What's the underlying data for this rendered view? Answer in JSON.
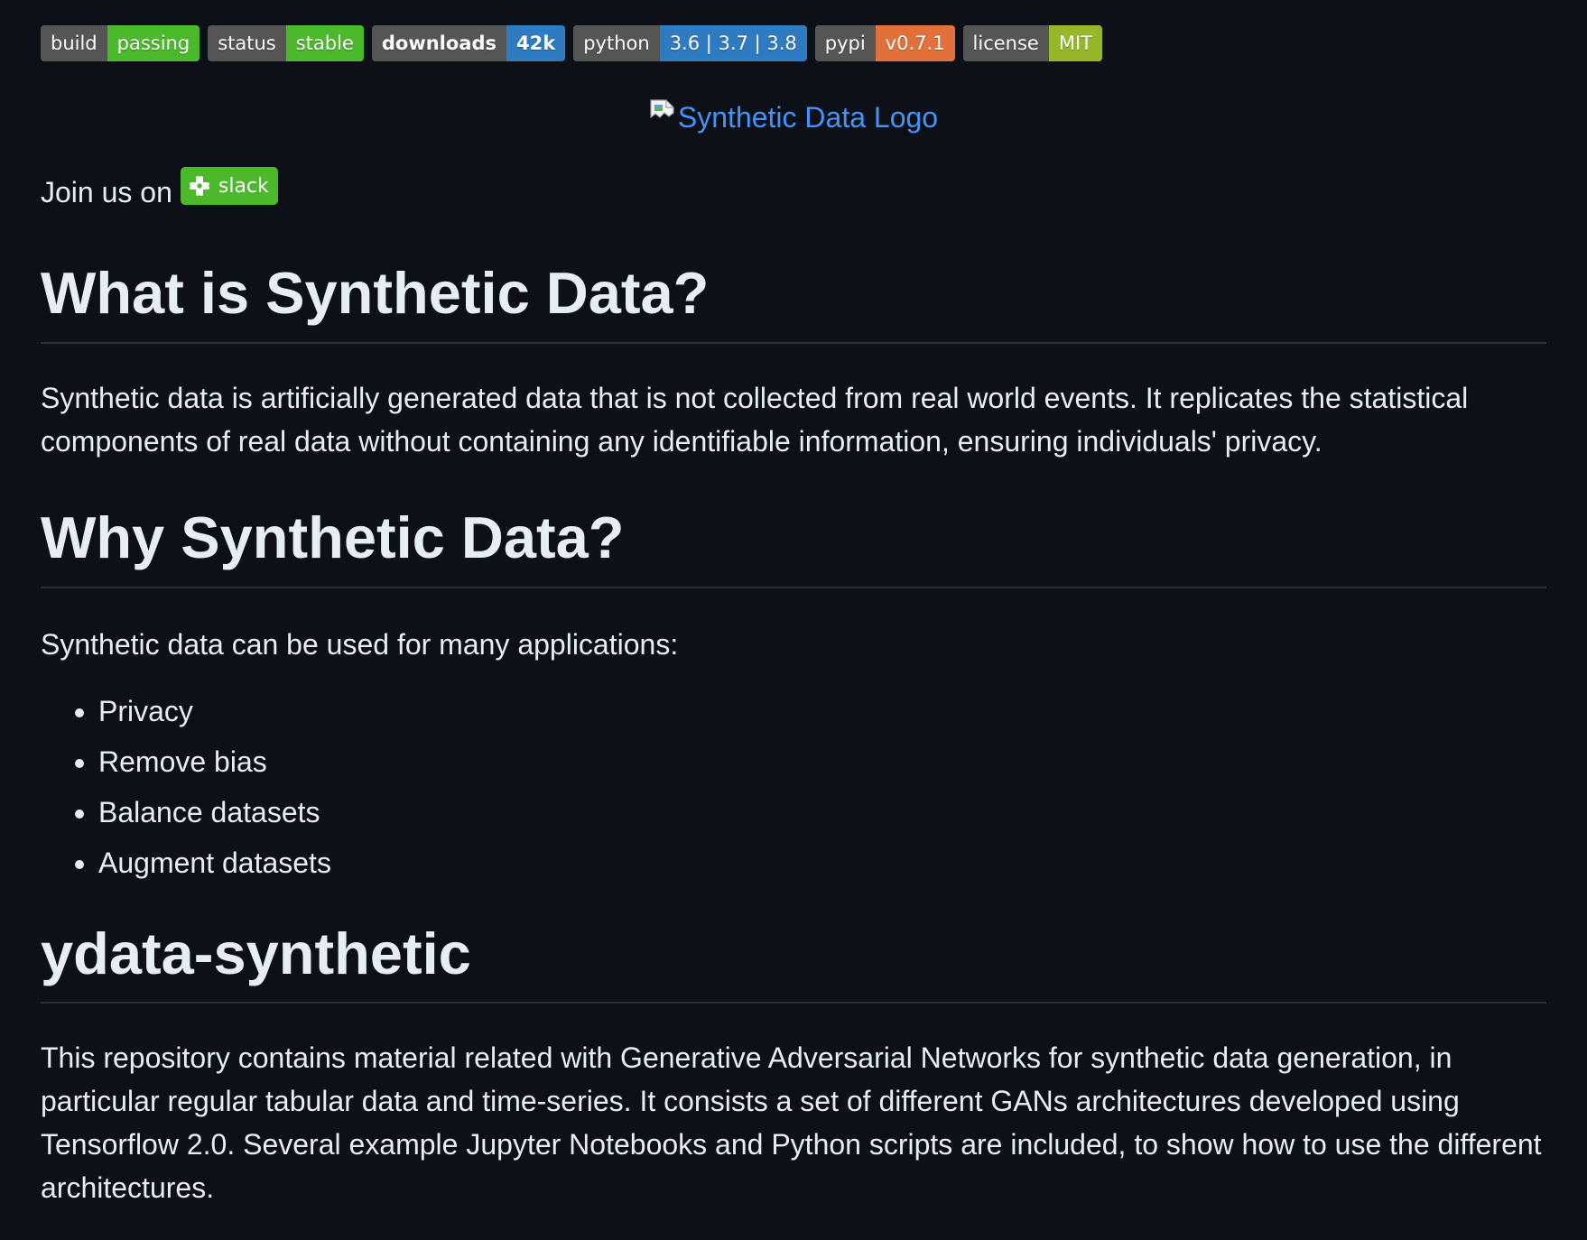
{
  "badges": [
    {
      "label": "build",
      "value": "passing",
      "color": "#4cb82b",
      "bold": false
    },
    {
      "label": "status",
      "value": "stable",
      "color": "#4cb82b",
      "bold": false
    },
    {
      "label": "downloads",
      "value": "42k",
      "color": "#2f7bc1",
      "bold": true
    },
    {
      "label": "python",
      "value": "3.6 | 3.7 | 3.8",
      "color": "#2f7bc1",
      "bold": false
    },
    {
      "label": "pypi",
      "value": "v0.7.1",
      "color": "#e2703a",
      "bold": false
    },
    {
      "label": "license",
      "value": "MIT",
      "color": "#97b62a",
      "bold": false
    }
  ],
  "logo": {
    "alt": "Synthetic Data Logo",
    "link_color": "#4493f8"
  },
  "join": {
    "text": "Join us on",
    "slack_label": "slack",
    "slack_color": "#4cb82b"
  },
  "sections": {
    "what": {
      "heading": "What is Synthetic Data?",
      "body": "Synthetic data is artificially generated data that is not collected from real world events. It replicates the statistical components of real data without containing any identifiable information, ensuring individuals' privacy."
    },
    "why": {
      "heading": "Why Synthetic Data?",
      "intro": "Synthetic data can be used for many applications:",
      "items": [
        "Privacy",
        "Remove bias",
        "Balance datasets",
        "Augment datasets"
      ]
    },
    "ydata": {
      "heading": "ydata-synthetic",
      "body": "This repository contains material related with Generative Adversarial Networks for synthetic data generation, in particular regular tabular data and time-series. It consists a set of different GANs architectures developed using Tensorflow 2.0. Several example Jupyter Notebooks and Python scripts are included, to show how to use the different architectures."
    }
  }
}
